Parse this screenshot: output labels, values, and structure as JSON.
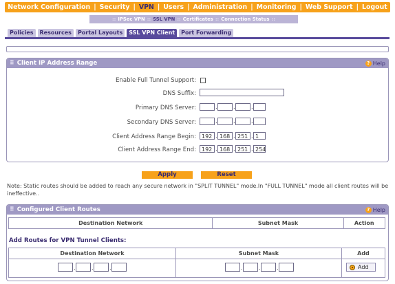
{
  "topnav": {
    "items": [
      "Network Configuration",
      "Security",
      "VPN",
      "Users",
      "Administration",
      "Monitoring",
      "Web Support",
      "Logout"
    ],
    "separator": "|",
    "active_index": 2
  },
  "subnav": {
    "items": [
      "IPSec VPN",
      "SSL VPN",
      "Certificates",
      "Connection Status"
    ],
    "separator": "::",
    "active_index": 1
  },
  "tabs": {
    "items": [
      "Policies",
      "Resources",
      "Portal Layouts",
      "SSL VPN Client",
      "Port Forwarding"
    ],
    "active_index": 3
  },
  "client_ip": {
    "title": "Client IP Address Range",
    "help": "Help",
    "full_tunnel_label": "Enable Full Tunnel Support:",
    "full_tunnel_checked": false,
    "dns_suffix_label": "DNS Suffix:",
    "dns_suffix_value": "",
    "primary_dns_label": "Primary DNS Server:",
    "primary_dns": [
      "",
      "",
      "",
      ""
    ],
    "secondary_dns_label": "Secondary DNS Server:",
    "secondary_dns": [
      "",
      "",
      "",
      ""
    ],
    "range_begin_label": "Client Address Range Begin:",
    "range_begin": [
      "192",
      "168",
      "251",
      "1"
    ],
    "range_end_label": "Client Address Range End:",
    "range_end": [
      "192",
      "168",
      "251",
      "254"
    ]
  },
  "buttons": {
    "apply": "Apply",
    "reset": "Reset"
  },
  "note": "Note: Static routes should be added to reach any secure network in \"SPLIT TUNNEL\" mode.In \"FULL TUNNEL\" mode all client routes will be ineffective..",
  "routes": {
    "title": "Configured Client Routes",
    "help": "Help",
    "col_dest": "Destination Network",
    "col_mask": "Subnet Mask",
    "col_action": "Action",
    "add_title": "Add Routes for VPN Tunnel Clients:",
    "add_col_dest": "Destination Network",
    "add_col_mask": "Subnet Mask",
    "add_col_add": "Add",
    "add_button": "Add",
    "dest_octets": [
      "",
      "",
      "",
      ""
    ],
    "mask_octets": [
      "",
      "",
      "",
      ""
    ]
  },
  "colors": {
    "accent": "#f7a21b",
    "header": "#9f99c4",
    "tab_active": "#584a9c"
  },
  "icons": {
    "help": "help-icon",
    "add": "add-icon",
    "grip": "grip-icon"
  }
}
